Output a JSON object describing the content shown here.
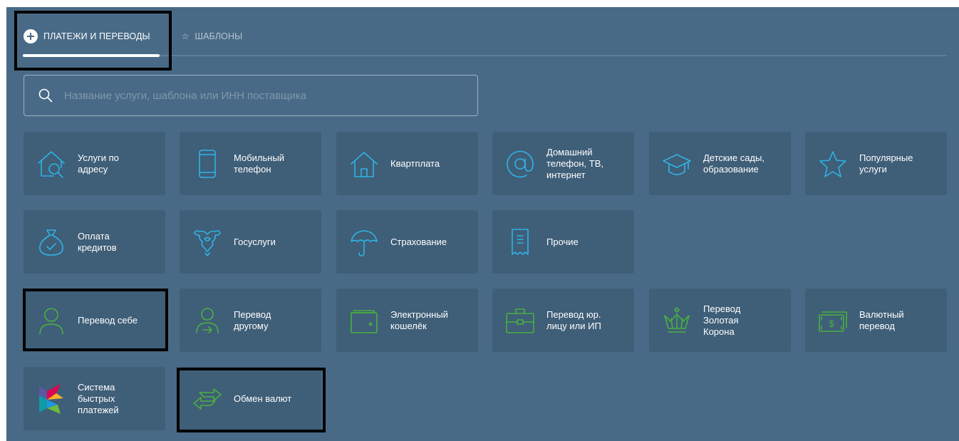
{
  "tabs": {
    "payments": {
      "label": "ПЛАТЕЖИ И ПЕРЕВОДЫ",
      "icon": "plus-circle-icon"
    },
    "templates": {
      "label": "ШАБЛОНЫ",
      "icon": "star-icon"
    }
  },
  "search": {
    "placeholder": "Название услуги, шаблона или ИНН поставщика",
    "value": ""
  },
  "colors": {
    "background": "#486a86",
    "tile": "#3f5e78",
    "icon_blue": "#2fb3e6",
    "icon_green": "#49b13e"
  },
  "tiles": {
    "address_services": {
      "label": "Услуги по\nадресу",
      "icon": "house-search-icon"
    },
    "mobile": {
      "label": "Мобильный\nтелефон",
      "icon": "smartphone-icon"
    },
    "rent": {
      "label": "Квартплата",
      "icon": "house-icon"
    },
    "home_phone": {
      "label": "Домашний\nтелефон, ТВ,\nинтернет",
      "icon": "at-sign-icon"
    },
    "kindergarten": {
      "label": "Детские сады,\nобразование",
      "icon": "graduation-cap-icon"
    },
    "popular": {
      "label": "Популярные\nуслуги",
      "icon": "star-icon"
    },
    "loans": {
      "label": "Оплата\nкредитов",
      "icon": "money-bag-icon"
    },
    "gosuslugi": {
      "label": "Госуслуги",
      "icon": "emblem-icon"
    },
    "insurance": {
      "label": "Страхование",
      "icon": "umbrella-icon"
    },
    "other": {
      "label": "Прочие",
      "icon": "receipt-icon"
    },
    "transfer_self": {
      "label": "Перевод себе",
      "icon": "user-icon"
    },
    "transfer_other": {
      "label": "Перевод\nдругому",
      "icon": "user-arrow-icon"
    },
    "ewallet": {
      "label": "Электронный\nкошелёк",
      "icon": "wallet-icon"
    },
    "transfer_legal": {
      "label": "Перевод юр.\nлицу или ИП",
      "icon": "briefcase-icon"
    },
    "zolotaya_korona": {
      "label": "Перевод\nЗолотая\nКорона",
      "icon": "crown-icon"
    },
    "currency_transfer": {
      "label": "Валютный\nперевод",
      "icon": "dollar-banknote-icon"
    },
    "sbp": {
      "label": "Система\nбыстрых\nплатежей",
      "icon": "sbp-logo-icon"
    },
    "currency_exchange": {
      "label": "Обмен валют",
      "icon": "exchange-arrows-icon"
    }
  }
}
